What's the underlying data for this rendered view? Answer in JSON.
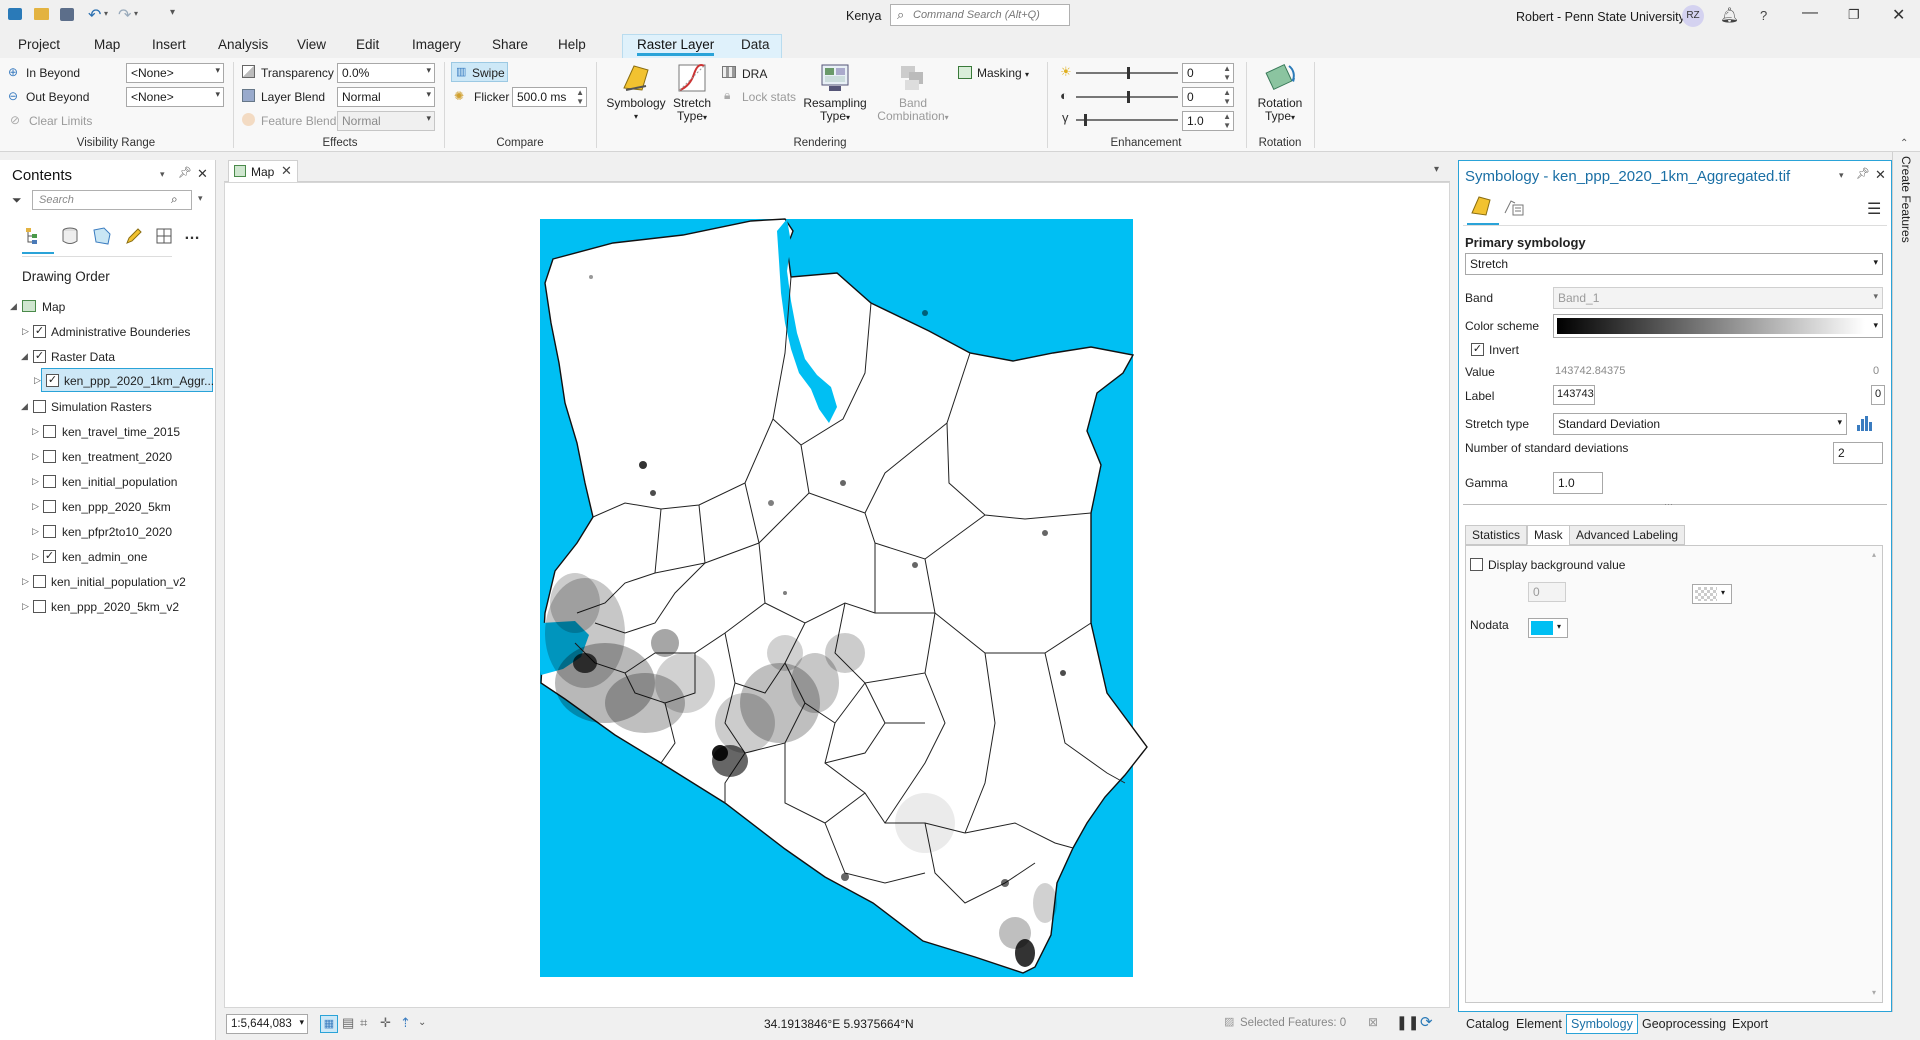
{
  "title_bar": {
    "document": "Kenya",
    "search_placeholder": "Command Search (Alt+Q)",
    "user": "Robert - Penn State University",
    "avatar_initials": "RZ",
    "help": "?"
  },
  "ribbon_tabs": [
    "Project",
    "Map",
    "Insert",
    "Analysis",
    "View",
    "Edit",
    "Imagery",
    "Share",
    "Help",
    "Raster Layer",
    "Data"
  ],
  "ribbon": {
    "visibility_range": {
      "label": "Visibility Range",
      "in_beyond": "In Beyond",
      "out_beyond": "Out Beyond",
      "clear_limits": "Clear Limits",
      "in_value": "<None>",
      "out_value": "<None>"
    },
    "effects": {
      "label": "Effects",
      "transparency": "Transparency",
      "transparency_value": "0.0%",
      "layer_blend": "Layer Blend",
      "layer_blend_value": "Normal",
      "feature_blend": "Feature Blend",
      "feature_blend_value": "Normal"
    },
    "compare": {
      "label": "Compare",
      "swipe": "Swipe",
      "flicker": "Flicker",
      "flicker_value": "500.0  ms"
    },
    "rendering": {
      "label": "Rendering",
      "symbology": "Symbology",
      "stretch_type_1": "Stretch",
      "stretch_type_2": "Type",
      "dra": "DRA",
      "lock_stats": "Lock stats",
      "resampling_1": "Resampling",
      "resampling_2": "Type",
      "band_comb_1": "Band",
      "band_comb_2": "Combination",
      "masking": "Masking"
    },
    "enhancement": {
      "label": "Enhancement",
      "brightness": "0",
      "contrast": "0",
      "gamma": "1.0"
    },
    "rotation": {
      "label": "Rotation",
      "rotation_type_1": "Rotation",
      "rotation_type_2": "Type"
    }
  },
  "contents": {
    "title": "Contents",
    "search_placeholder": "Search",
    "drawing_order": "Drawing Order",
    "items": [
      {
        "label": "Map",
        "checked": false,
        "level": 0
      },
      {
        "label": "Administrative Bounderies",
        "checked": true,
        "level": 1
      },
      {
        "label": "Raster Data",
        "checked": true,
        "level": 1
      },
      {
        "label": "ken_ppp_2020_1km_Aggr...",
        "checked": true,
        "level": 2
      },
      {
        "label": "Simulation Rasters",
        "checked": false,
        "level": 1
      },
      {
        "label": "ken_travel_time_2015",
        "checked": false,
        "level": 2
      },
      {
        "label": "ken_treatment_2020",
        "checked": false,
        "level": 2
      },
      {
        "label": "ken_initial_population",
        "checked": false,
        "level": 2
      },
      {
        "label": "ken_ppp_2020_5km",
        "checked": false,
        "level": 2
      },
      {
        "label": "ken_pfpr2to10_2020",
        "checked": false,
        "level": 2
      },
      {
        "label": "ken_admin_one",
        "checked": true,
        "level": 2
      },
      {
        "label": "ken_initial_population_v2",
        "checked": false,
        "level": 1
      },
      {
        "label": "ken_ppp_2020_5km_v2",
        "checked": false,
        "level": 1
      }
    ]
  },
  "map": {
    "tab_label": "Map",
    "scale": "1:5,644,083",
    "coordinates": "34.1913846°E 5.9375664°N",
    "selected_features": "Selected Features: 0",
    "nodata_color": "#00bff3"
  },
  "symbology": {
    "title": "Symbology - ken_ppp_2020_1km_Aggregated.tif",
    "primary": "Primary symbology",
    "renderer": "Stretch",
    "band_label": "Band",
    "band_value": "Band_1",
    "color_scheme": "Color scheme",
    "invert": "Invert",
    "value_label": "Value",
    "value_high": "143742.84375",
    "value_low": "0",
    "label_label": "Label",
    "label_high": "143743",
    "label_low": "0",
    "stretch_type_label": "Stretch type",
    "stretch_type": "Standard Deviation",
    "num_std_label": "Number of standard deviations",
    "num_std": "2",
    "gamma_label": "Gamma",
    "gamma": "1.0",
    "tabs": [
      "Statistics",
      "Mask",
      "Advanced Labeling"
    ],
    "display_background": "Display background value",
    "background_value": "0",
    "nodata": "Nodata"
  },
  "right_strip": "Create Features",
  "bottom_tabs": [
    "Catalog",
    "Element",
    "Symbology",
    "Geoprocessing",
    "Export"
  ]
}
